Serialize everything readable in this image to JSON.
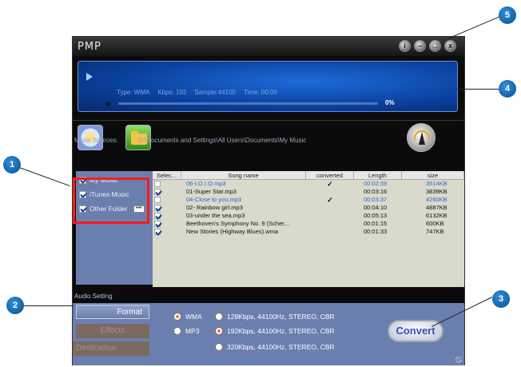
{
  "app": {
    "title": "PMP",
    "window_buttons": [
      "i",
      "–",
      "□",
      "x"
    ]
  },
  "player": {
    "type": "Type: WMA",
    "kbps": "Kbps: 192",
    "sample": "Sample:44100",
    "time": "Time: 00:00",
    "progress_percent": 0,
    "percent_label": "0%"
  },
  "sources": {
    "label": "Music Sources:",
    "path": "D:\\Documents and Settings\\All Users\\Documents\\My Music"
  },
  "folders": [
    {
      "label": "My Music",
      "checked": true
    },
    {
      "label": "iTunes Music",
      "checked": true
    },
    {
      "label": "Other Folder",
      "checked": true,
      "dots": "•••"
    }
  ],
  "table": {
    "headers": [
      "Selec...",
      "Song name",
      "converted",
      "Length",
      "size"
    ],
    "rows": [
      {
        "checked": false,
        "name": "06-I.O.I.O.mp3",
        "converted": "✓",
        "length": "00:02:59",
        "size": "3514KB",
        "selected": true
      },
      {
        "checked": true,
        "name": "01-Super Star.mp3",
        "converted": "",
        "length": "00:03:16",
        "size": "3839KB",
        "selected": false
      },
      {
        "checked": false,
        "name": "04-Close to you.mp3",
        "converted": "✓",
        "length": "00:03:37",
        "size": "4260KB",
        "selected": true
      },
      {
        "checked": true,
        "name": "02- Rainbow girl.mp3",
        "converted": "",
        "length": "00:04:10",
        "size": "4887KB",
        "selected": false
      },
      {
        "checked": true,
        "name": "03-under the sea.mp3",
        "converted": "",
        "length": "00:05:13",
        "size": "6132KB",
        "selected": false
      },
      {
        "checked": true,
        "name": "Beethoven's Symphony No. 9 (Scher...",
        "converted": "",
        "length": "00:01:15",
        "size": "600KB",
        "selected": false
      },
      {
        "checked": true,
        "name": "New Stories (Highway Blues).wma",
        "converted": "",
        "length": "00:01:33",
        "size": "747KB",
        "selected": false
      }
    ]
  },
  "settings": {
    "section_label": "Audio Setting",
    "tabs": [
      "Format",
      "Effects",
      "Destination"
    ],
    "formats": [
      {
        "label": "WMA",
        "selected": true
      },
      {
        "label": "MP3",
        "selected": false
      }
    ],
    "qualities": [
      {
        "label": "128Kbps, 44100Hz, STEREO, CBR",
        "selected": false
      },
      {
        "label": "192Kbps, 44100Hz, STEREO, CBR",
        "selected": true
      },
      {
        "label": "320Kbps, 44100Hz, STEREO, CBR",
        "selected": false
      }
    ],
    "convert_label": "Convert"
  },
  "callouts": [
    "1",
    "2",
    "3",
    "4",
    "5"
  ],
  "colors": {
    "accent_blue": "#0a3f9c",
    "panel": "#6b7fae",
    "highlight_red": "#ff1a1a",
    "callout_blue": "#0b4f8f"
  }
}
